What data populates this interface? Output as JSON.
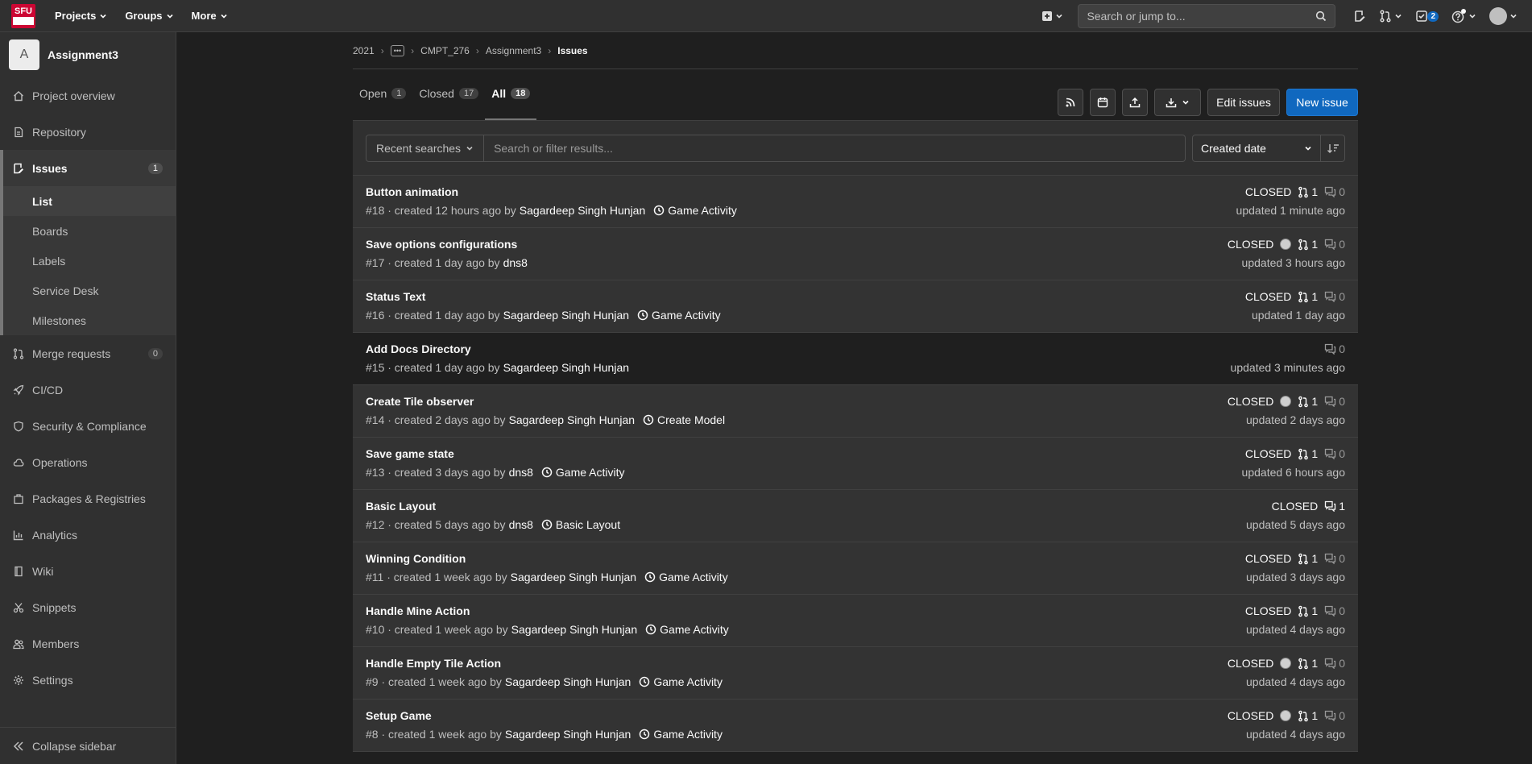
{
  "topbar": {
    "logo_text": "SFU",
    "menus": [
      "Projects",
      "Groups",
      "More"
    ],
    "search_placeholder": "Search or jump to...",
    "todo_count": "2"
  },
  "sidebar": {
    "project_initial": "A",
    "project_name": "Assignment3",
    "items": [
      {
        "label": "Project overview",
        "icon": "home-icon"
      },
      {
        "label": "Repository",
        "icon": "doc-icon"
      },
      {
        "label": "Issues",
        "icon": "issues-icon",
        "count": "1"
      },
      {
        "label": "Merge requests",
        "icon": "merge-request-icon",
        "count": "0"
      },
      {
        "label": "CI/CD",
        "icon": "rocket-icon"
      },
      {
        "label": "Security & Compliance",
        "icon": "shield-icon"
      },
      {
        "label": "Operations",
        "icon": "cloud-icon"
      },
      {
        "label": "Packages & Registries",
        "icon": "package-icon"
      },
      {
        "label": "Analytics",
        "icon": "chart-icon"
      },
      {
        "label": "Wiki",
        "icon": "book-icon"
      },
      {
        "label": "Snippets",
        "icon": "scissors-icon"
      },
      {
        "label": "Members",
        "icon": "users-icon"
      },
      {
        "label": "Settings",
        "icon": "gear-icon"
      }
    ],
    "issues_sub": [
      "List",
      "Boards",
      "Labels",
      "Service Desk",
      "Milestones"
    ],
    "collapse_label": "Collapse sidebar"
  },
  "breadcrumb": [
    "2021",
    "CMPT_276",
    "Assignment3",
    "Issues"
  ],
  "tabs": [
    {
      "label": "Open",
      "count": "1"
    },
    {
      "label": "Closed",
      "count": "17"
    },
    {
      "label": "All",
      "count": "18"
    }
  ],
  "actions": {
    "edit_label": "Edit issues",
    "new_label": "New issue"
  },
  "filter": {
    "recent_label": "Recent searches",
    "search_placeholder": "Search or filter results...",
    "sort_label": "Created date"
  },
  "issues": [
    {
      "title": "Button animation",
      "prefix": "#18 · created 12 hours ago by",
      "author": "Sagardeep Singh Hunjan",
      "milestone": "Game Activity",
      "status": "CLOSED",
      "mr": "1",
      "comments": "0",
      "updated": "updated 1 minute ago",
      "assignee": false
    },
    {
      "title": "Save options configurations",
      "prefix": "#17 · created 1 day ago by",
      "author": "dns8",
      "milestone": "",
      "status": "CLOSED",
      "mr": "1",
      "comments": "0",
      "updated": "updated 3 hours ago",
      "assignee": true
    },
    {
      "title": "Status Text",
      "prefix": "#16 · created 1 day ago by",
      "author": "Sagardeep Singh Hunjan",
      "milestone": "Game Activity",
      "status": "CLOSED",
      "mr": "1",
      "comments": "0",
      "updated": "updated 1 day ago",
      "assignee": false
    },
    {
      "title": "Add Docs Directory",
      "prefix": "#15 · created 1 day ago by",
      "author": "Sagardeep Singh Hunjan",
      "milestone": "",
      "status": "",
      "mr": "",
      "comments": "0",
      "updated": "updated 3 minutes ago",
      "assignee": false
    },
    {
      "title": "Create Tile observer",
      "prefix": "#14 · created 2 days ago by",
      "author": "Sagardeep Singh Hunjan",
      "milestone": "Create Model",
      "status": "CLOSED",
      "mr": "1",
      "comments": "0",
      "updated": "updated 2 days ago",
      "assignee": true
    },
    {
      "title": "Save game state",
      "prefix": "#13 · created 3 days ago by",
      "author": "dns8",
      "milestone": "Game Activity",
      "status": "CLOSED",
      "mr": "1",
      "comments": "0",
      "updated": "updated 6 hours ago",
      "assignee": false
    },
    {
      "title": "Basic Layout",
      "prefix": "#12 · created 5 days ago by",
      "author": "dns8",
      "milestone": "Basic Layout",
      "status": "CLOSED",
      "mr": "",
      "comments": "1",
      "updated": "updated 5 days ago",
      "assignee": false
    },
    {
      "title": "Winning Condition",
      "prefix": "#11 · created 1 week ago by",
      "author": "Sagardeep Singh Hunjan",
      "milestone": "Game Activity",
      "status": "CLOSED",
      "mr": "1",
      "comments": "0",
      "updated": "updated 3 days ago",
      "assignee": false
    },
    {
      "title": "Handle Mine Action",
      "prefix": "#10 · created 1 week ago by",
      "author": "Sagardeep Singh Hunjan",
      "milestone": "Game Activity",
      "status": "CLOSED",
      "mr": "1",
      "comments": "0",
      "updated": "updated 4 days ago",
      "assignee": false
    },
    {
      "title": "Handle Empty Tile Action",
      "prefix": "#9 · created 1 week ago by",
      "author": "Sagardeep Singh Hunjan",
      "milestone": "Game Activity",
      "status": "CLOSED",
      "mr": "1",
      "comments": "0",
      "updated": "updated 4 days ago",
      "assignee": true
    },
    {
      "title": "Setup Game",
      "prefix": "#8 · created 1 week ago by",
      "author": "Sagardeep Singh Hunjan",
      "milestone": "Game Activity",
      "status": "CLOSED",
      "mr": "1",
      "comments": "0",
      "updated": "updated 4 days ago",
      "assignee": true
    }
  ]
}
